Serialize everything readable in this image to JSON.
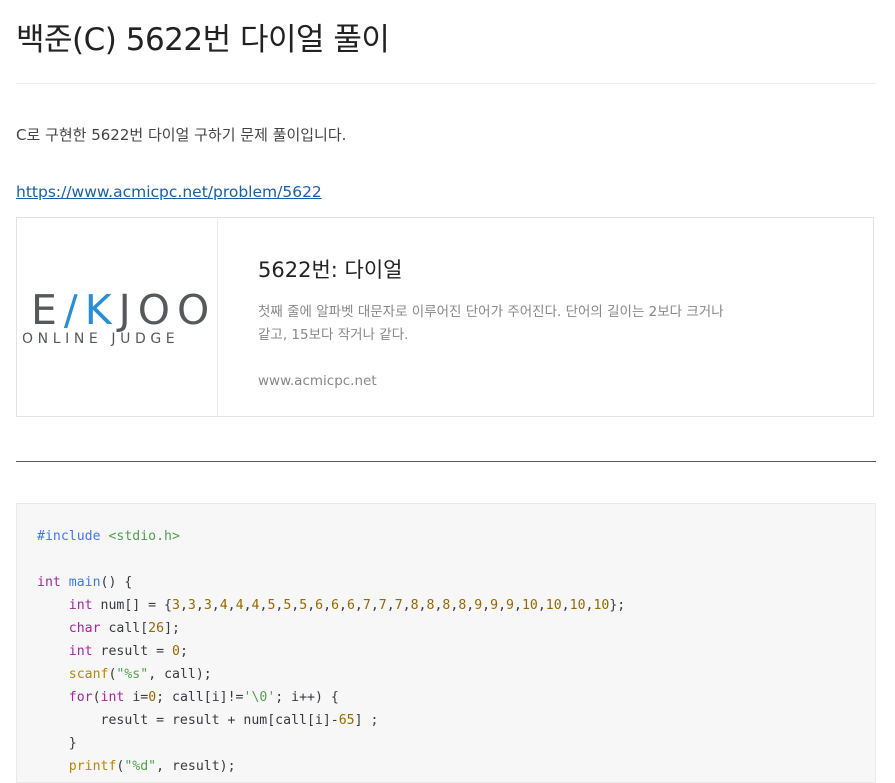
{
  "post": {
    "title": "백준(C) 5622번 다이얼 풀이",
    "intro": "C로 구현한 5622번 다이얼 구하기 문제 풀이입니다.",
    "link_text": "https://www.acmicpc.net/problem/5622"
  },
  "preview_card": {
    "logo_main_left": "E",
    "logo_main_k": "/K",
    "logo_main_right": "JOO",
    "logo_sub": "ONLINE JUDGE",
    "title": "5622번: 다이얼",
    "description": "첫째 줄에 알파벳 대문자로 이루어진 단어가 주어진다. 단어의 길이는 2보다 크거나 같고, 15보다 작거나 같다.",
    "domain": "www.acmicpc.net"
  },
  "code": {
    "lines": [
      "#include <stdio.h>",
      "",
      "int main() {",
      "    int num[] = {3,3,3,4,4,4,5,5,5,6,6,6,7,7,7,8,8,8,8,9,9,9,10,10,10,10};",
      "    char call[26];",
      "    int result = 0;",
      "    scanf(\"%s\", call);",
      "    for(int i=0; call[i]!='\\0'; i++) {",
      "        result = result + num[call[i]-65] ;",
      "    }",
      "    printf(\"%d\", result);"
    ]
  }
}
